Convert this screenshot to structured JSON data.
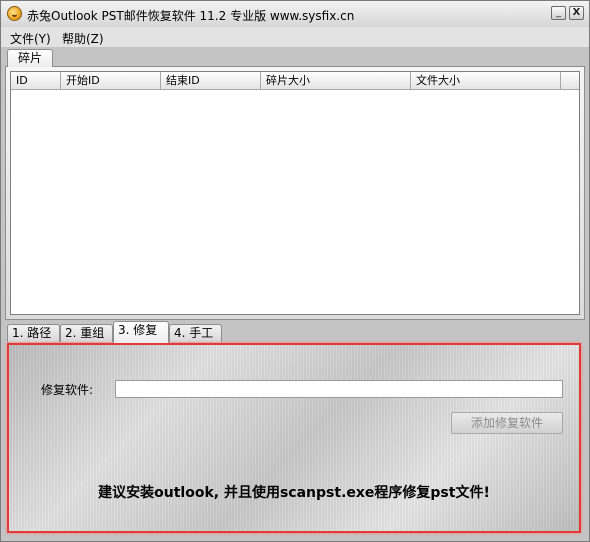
{
  "window": {
    "title": "赤兔Outlook PST邮件恢复软件 11.2 专业版 www.sysfix.cn",
    "minimize_label": "_",
    "close_label": "X"
  },
  "menu": {
    "items": [
      {
        "label": "文件(Y)"
      },
      {
        "label": "帮助(Z)"
      }
    ]
  },
  "top_tabs": [
    {
      "label": "碎片"
    }
  ],
  "list": {
    "columns": [
      "ID",
      "开始ID",
      "结束ID",
      "碎片大小",
      "文件大小"
    ],
    "rows": []
  },
  "bottom_tabs": [
    {
      "label": "1. 路径"
    },
    {
      "label": "2. 重组"
    },
    {
      "label": "3. 修复"
    },
    {
      "label": "4. 手工"
    }
  ],
  "repair": {
    "field_label": "修复软件:",
    "field_value": "",
    "add_button_label": "添加修复软件",
    "hint": "建议安装outlook, 并且使用scanpst.exe程序修复pst文件!"
  },
  "colors": {
    "highlight_border": "#e13a3a"
  }
}
